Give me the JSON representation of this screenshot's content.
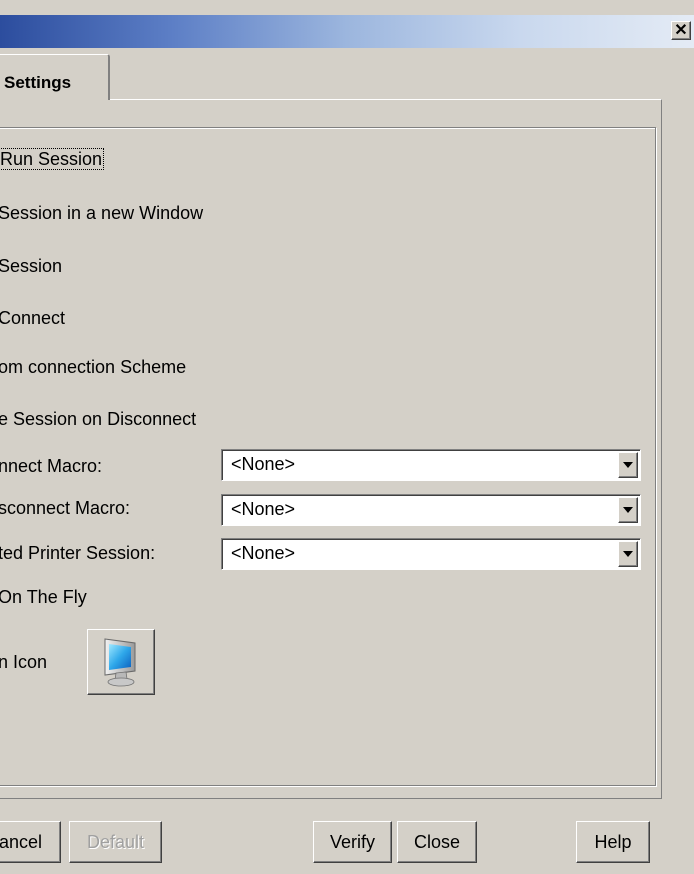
{
  "window": {
    "close_glyph": "✕",
    "title_gradient": [
      "#2c4d9e",
      "#e4ebf5"
    ]
  },
  "tabs": [
    {
      "label": "Settings",
      "selected": true
    }
  ],
  "options": [
    {
      "label": "Run Session",
      "focused": true
    },
    {
      "label": "Session in a new Window"
    },
    {
      "label": "Session"
    },
    {
      "label": "Connect"
    },
    {
      "label": "om connection Scheme"
    },
    {
      "label": "e Session on Disconnect"
    }
  ],
  "macros": [
    {
      "label": "nnect Macro:",
      "value": "<None>"
    },
    {
      "label": "sconnect Macro:",
      "value": "<None>"
    },
    {
      "label": "ted Printer Session:",
      "value": "<None>"
    }
  ],
  "on_the_fly": {
    "label": "On The Fly"
  },
  "session_icon": {
    "label": "n Icon",
    "icon": "monitor-icon"
  },
  "buttons": {
    "cancel": "ancel",
    "default": "Default",
    "verify": "Verify",
    "close": "Close",
    "help": "Help"
  }
}
